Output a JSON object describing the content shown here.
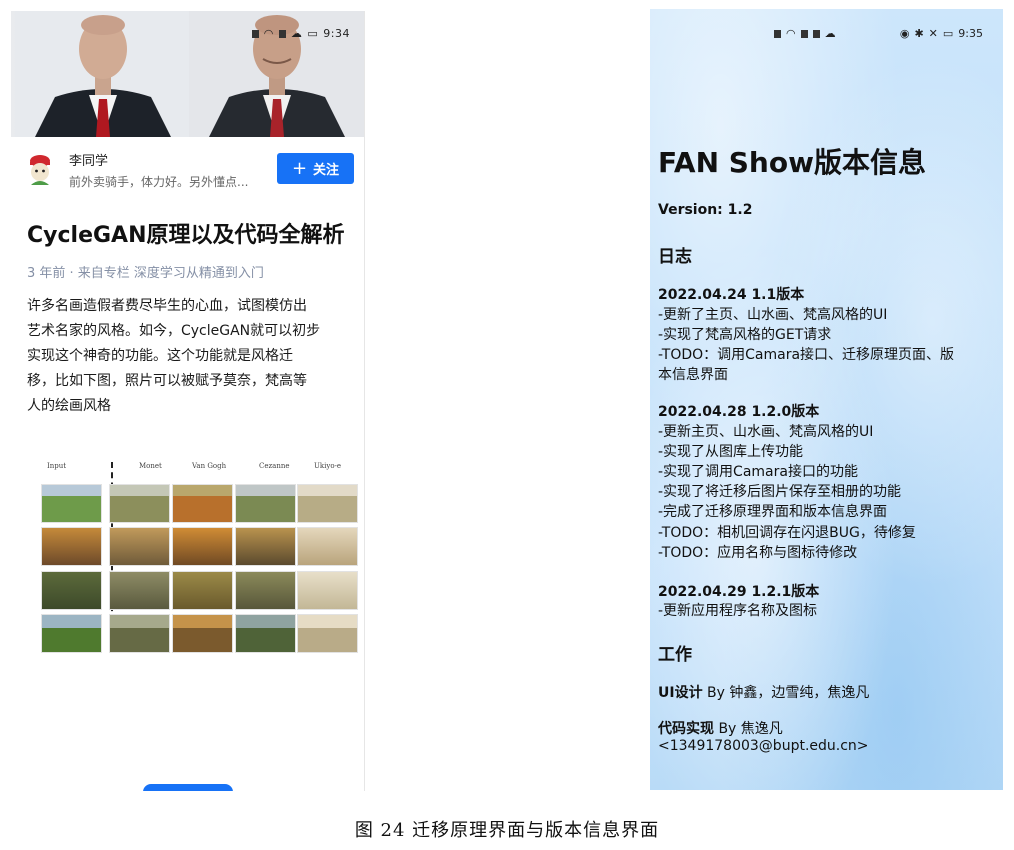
{
  "left_screen": {
    "status_time": "9:34",
    "author": {
      "name": "李同学",
      "description": "前外卖骑手，体力好。另外懂点...",
      "follow_label": "关注"
    },
    "article": {
      "title": "CycleGAN原理以及代码全解析",
      "meta": "3 年前 · 来自专栏 深度学习从精通到入门",
      "paragraph_lines": [
        "许多名画造假者费尽毕生的心血，试图模仿出",
        "艺术名家的风格。如今，CycleGAN就可以初步",
        "实现这个神奇的功能。这个功能就是风格迁",
        "移，比如下图，照片可以被赋予莫奈，梵高等",
        "人的绘画风格"
      ],
      "figure_columns": [
        "Input",
        "Monet",
        "Van Gogh",
        "Cezanne",
        "Ukiyo-e"
      ]
    }
  },
  "right_screen": {
    "status_time": "9:35",
    "title": "FAN Show版本信息",
    "version": "Version: 1.2",
    "log_heading": "日志",
    "logs": [
      {
        "date": "2022.04.24 1.1版本",
        "items": [
          "-更新了主页、山水画、梵高风格的UI",
          "-实现了梵高风格的GET请求",
          "-TODO：调用Camara接口、迁移原理页面、版",
          "本信息界面"
        ]
      },
      {
        "date": "2022.04.28 1.2.0版本",
        "items": [
          "-更新主页、山水画、梵高风格的UI",
          "-实现了从图库上传功能",
          "-实现了调用Camara接口的功能",
          "-实现了将迁移后图片保存至相册的功能",
          "-完成了迁移原理界面和版本信息界面",
          "-TODO：相机回调存在闪退BUG，待修复",
          "-TODO：应用名称与图标待修改"
        ]
      },
      {
        "date": "2022.04.29 1.2.1版本",
        "items": [
          "-更新应用程序名称及图标"
        ]
      }
    ],
    "work_heading": "工作",
    "ui_design": {
      "label": "UI设计",
      "text": " By 钟鑫，边雪纯，焦逸凡"
    },
    "code": {
      "label": "代码实现",
      "text": " By 焦逸凡",
      "email": "<1349178003@bupt.edu.cn>"
    }
  },
  "caption": "图 24 迁移原理界面与版本信息界面",
  "colors": {
    "follow_button": "#1772f6",
    "meta_text": "#8590a6"
  }
}
